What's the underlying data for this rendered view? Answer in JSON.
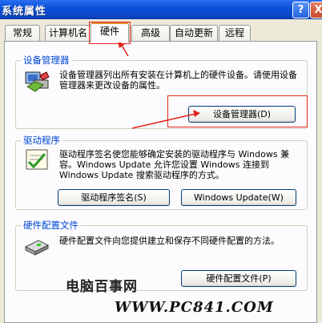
{
  "window": {
    "title": "系统属性",
    "help_label": "?",
    "close_label": "X"
  },
  "tabs": [
    {
      "label": "常规"
    },
    {
      "label": "计算机名"
    },
    {
      "label": "硬件"
    },
    {
      "label": "高级"
    },
    {
      "label": "自动更新"
    },
    {
      "label": "远程"
    }
  ],
  "groups": {
    "device_manager": {
      "title": "设备管理器",
      "description": "设备管理器列出所有安装在计算机上的硬件设备。请使用设备管理器来更改设备的属性。",
      "button": "设备管理器(D)"
    },
    "drivers": {
      "title": "驱动程序",
      "description": "驱动程序签名使您能够确定安装的驱动程序与 Windows 兼容。Windows Update 允许您设置 Windows 连接到 Windows Update 搜索驱动程序的方式。",
      "signing_button": "驱动程序签名(S)",
      "update_button": "Windows Update(W)"
    },
    "hardware_profiles": {
      "title": "硬件配置文件",
      "description": "硬件配置文件向您提供建立和保存不同硬件配置的方法。",
      "button": "硬件配置文件(P)"
    }
  },
  "watermark": {
    "site_name": "电脑百事网",
    "url": "WWW.PC841.COM"
  },
  "colors": {
    "annotation_red": "#e2231a",
    "group_title_blue": "#0046d5",
    "titlebar_blue": "#0b51d8"
  }
}
